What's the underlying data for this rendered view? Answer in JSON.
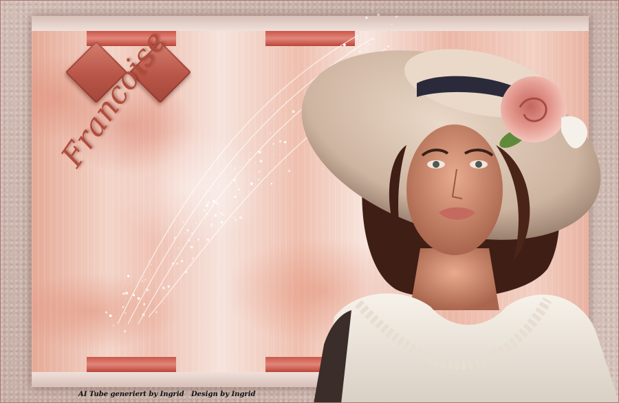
{
  "artwork": {
    "signature_text": "Francoise",
    "subject": "woman-in-wide-brim-hat-with-rose",
    "colors": {
      "background": "#cbb5ad",
      "panel_peach": "#efc1b2",
      "accent_red": "#c9584a",
      "signature": "#b14c3b",
      "hat": "#d8c1ae",
      "rose": "#e49a90",
      "blouse": "#f2ece4"
    }
  },
  "footer": {
    "credit_tube": "AI Tube generiert by Ingrid",
    "credit_design": "Design by Ingrid"
  }
}
